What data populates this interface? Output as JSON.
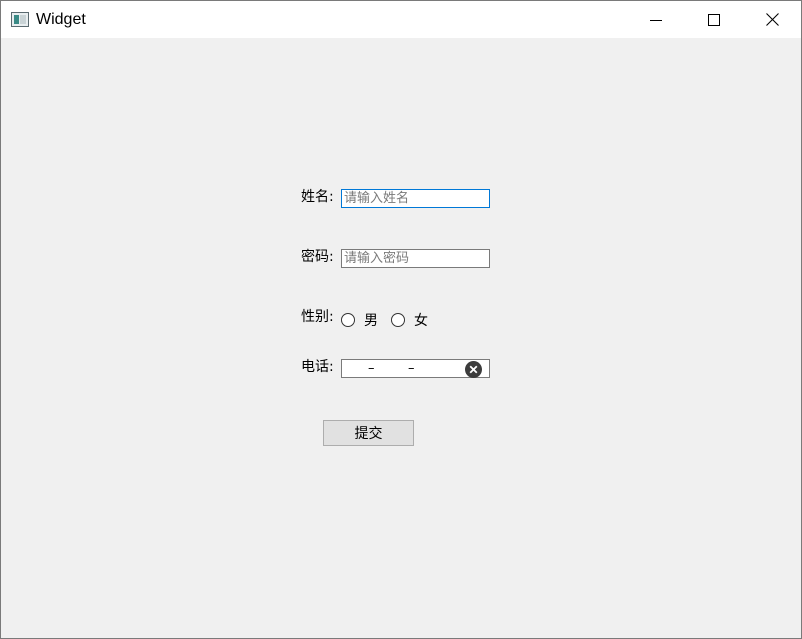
{
  "window": {
    "title": "Widget"
  },
  "form": {
    "name_label": "姓名:",
    "name_placeholder": "请输入姓名",
    "password_label": "密码:",
    "password_placeholder": "请输入密码",
    "gender_label": "性别:",
    "gender_options": [
      "男",
      "女"
    ],
    "phone_label": "电话:",
    "phone_mask_sep1": "–",
    "phone_mask_sep2": "–",
    "submit_label": "提交"
  },
  "icons": {
    "app": "app-window-icon",
    "minimize": "minimize-icon",
    "maximize": "maximize-icon",
    "close": "close-icon",
    "clear": "clear-circle-icon"
  },
  "colors": {
    "window_bg": "#f0f0f0",
    "focus_border": "#0078d7",
    "button_bg": "#e1e1e1"
  }
}
